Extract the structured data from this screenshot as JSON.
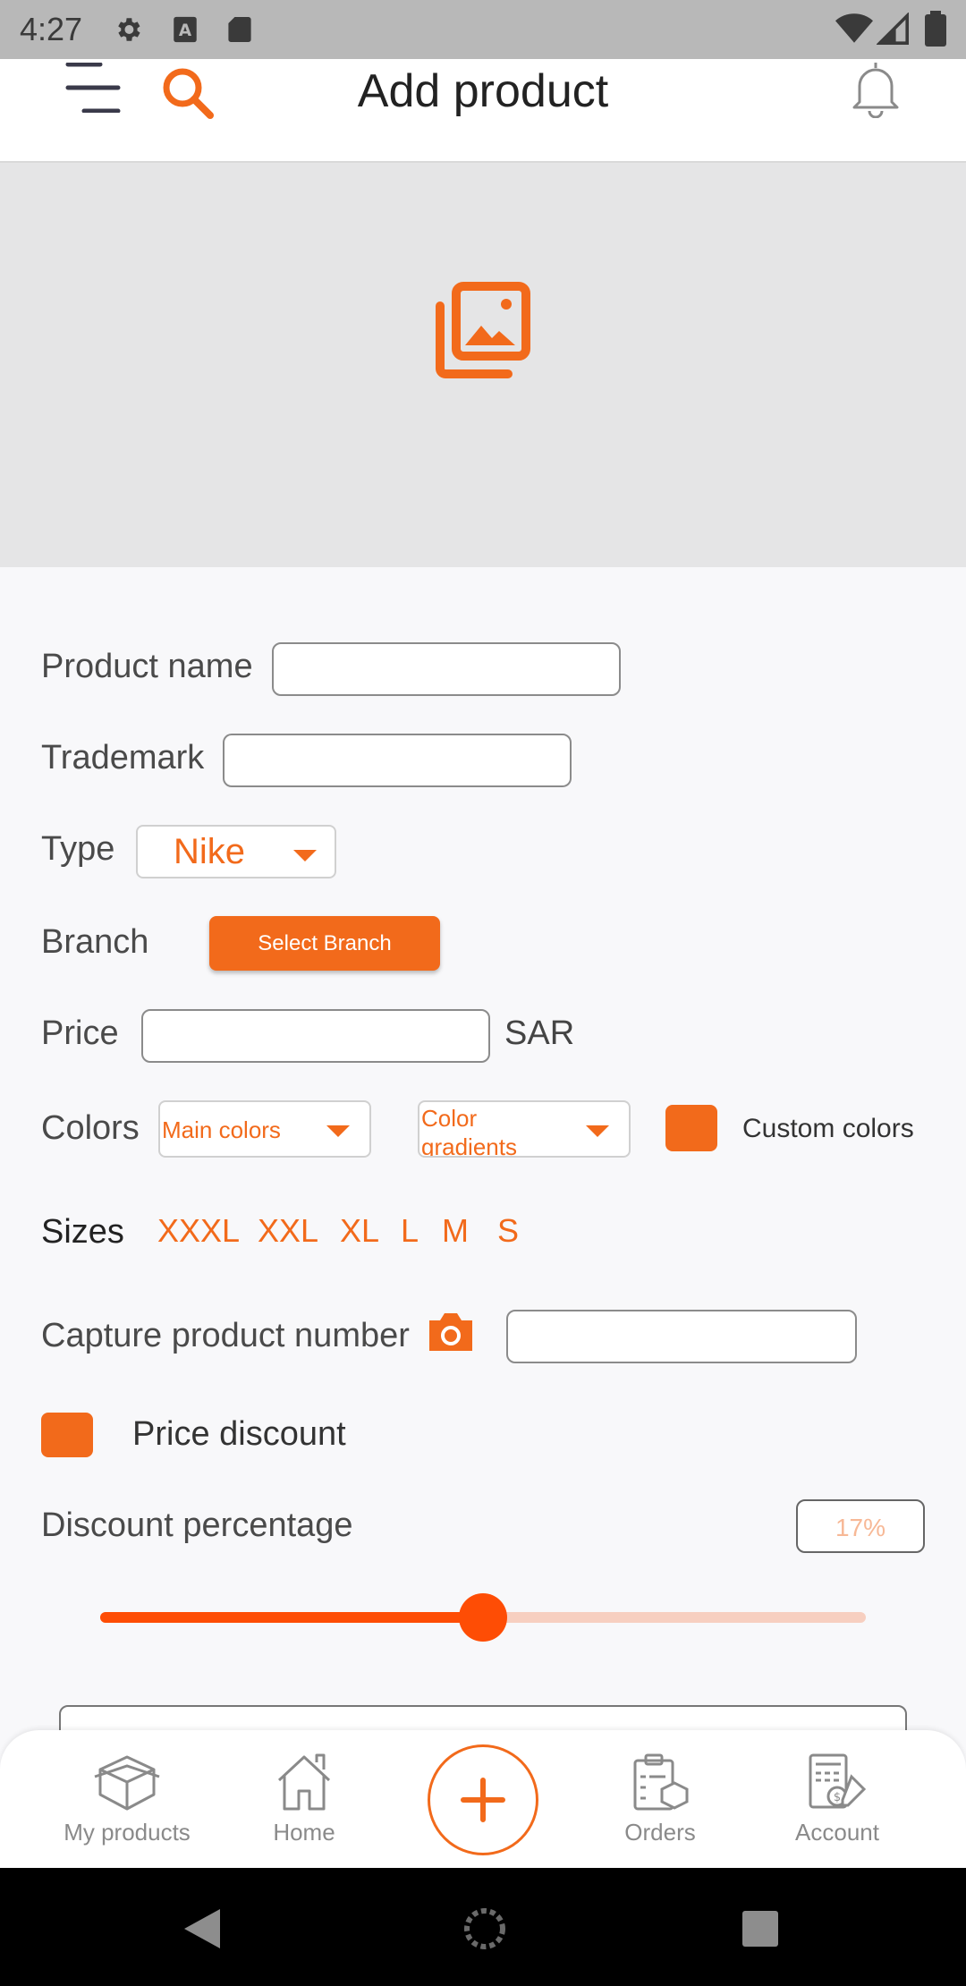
{
  "status_bar": {
    "time": "4:27"
  },
  "header": {
    "title": "Add product"
  },
  "form": {
    "product_name": {
      "label": "Product name",
      "value": ""
    },
    "trademark": {
      "label": "Trademark",
      "value": ""
    },
    "type": {
      "label": "Type",
      "selected": "Nike"
    },
    "branch": {
      "label": "Branch",
      "button": "Select  Branch"
    },
    "price": {
      "label": "Price",
      "value": "",
      "currency": "SAR"
    },
    "colors": {
      "label": "Colors",
      "main_colors": "Main colors",
      "color_gradients": "Color gradients",
      "custom_colors": "Custom colors"
    },
    "sizes": {
      "label": "Sizes",
      "options": [
        "XXXL",
        "XXL",
        "XL",
        "L",
        "M",
        "S"
      ]
    },
    "capture": {
      "label": "Capture product number",
      "value": ""
    },
    "price_discount": {
      "label": "Price discount",
      "checked": true
    },
    "discount": {
      "label": "Discount percentage",
      "value": "17%",
      "slider_fraction": 0.5
    }
  },
  "bottom_nav": {
    "items": [
      {
        "label": "My products",
        "icon": "box-icon"
      },
      {
        "label": "Home",
        "icon": "home-icon"
      },
      {
        "label": "",
        "icon": "plus-icon"
      },
      {
        "label": "Orders",
        "icon": "orders-icon"
      },
      {
        "label": "Account",
        "icon": "account-icon"
      }
    ]
  },
  "colors": {
    "accent": "#f26a1b",
    "slider_active": "#fe4d05",
    "slider_inactive": "#f7cfc0"
  }
}
